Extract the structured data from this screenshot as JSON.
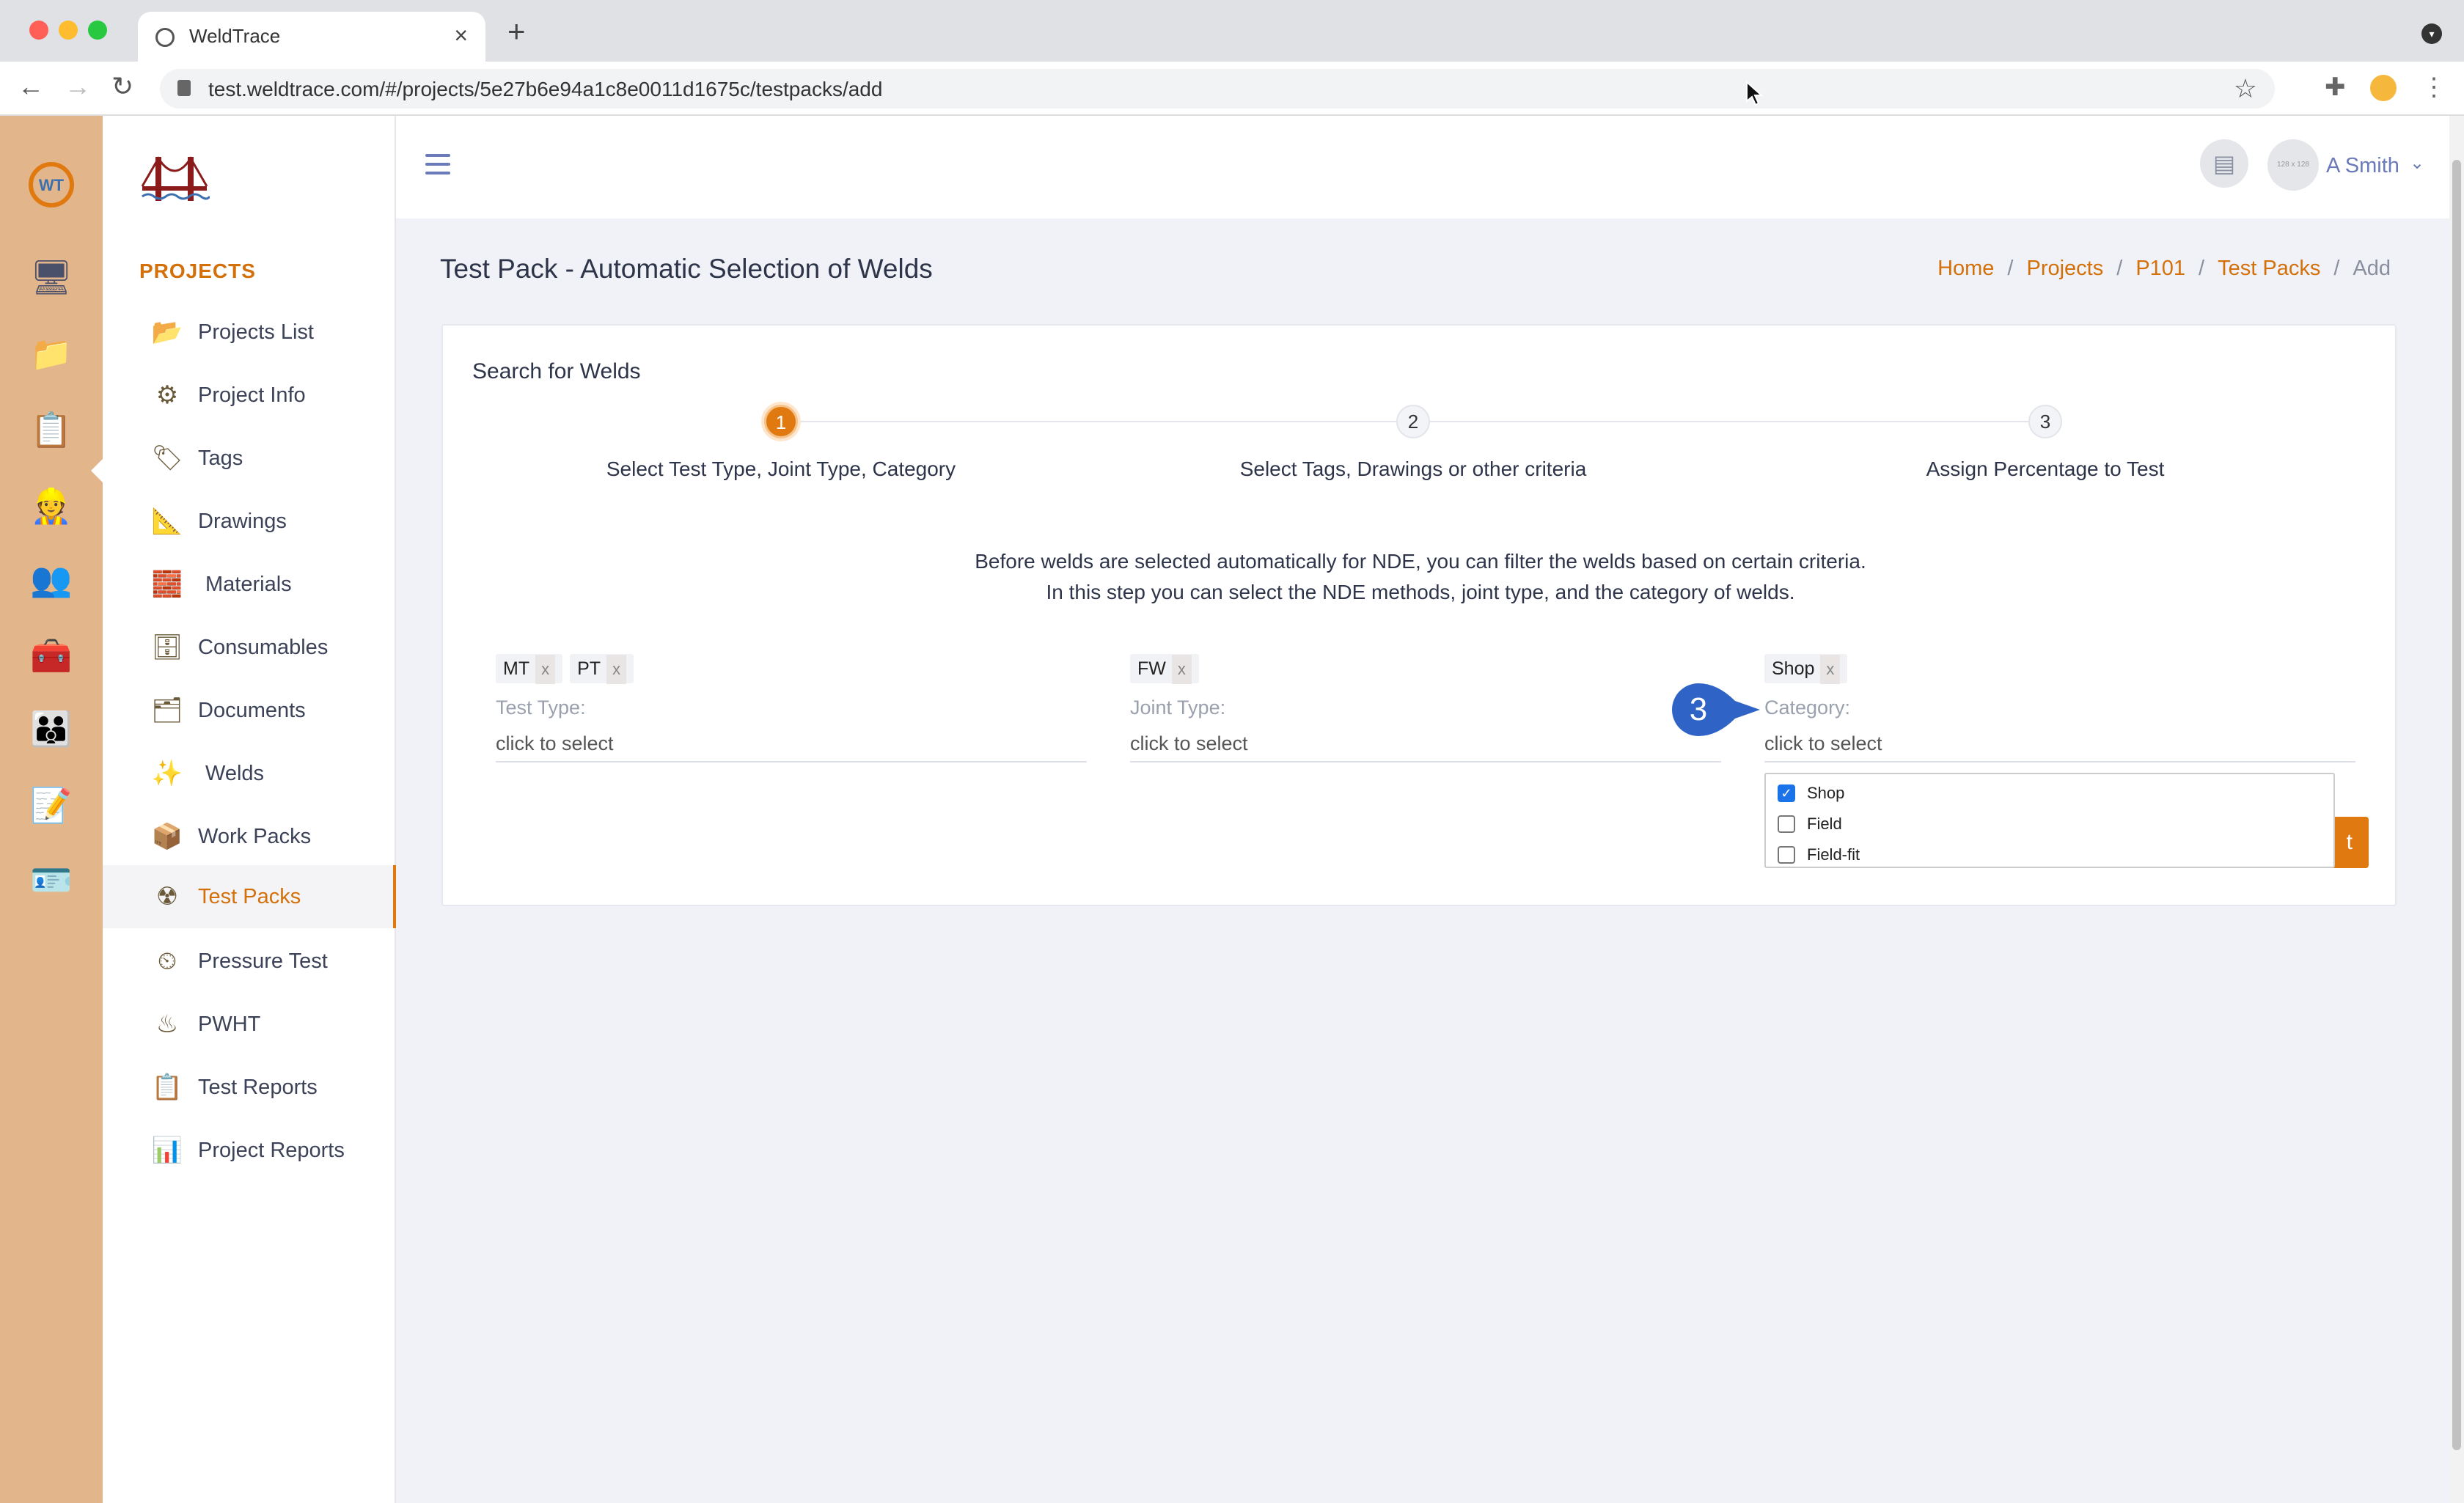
{
  "browser": {
    "tab_title": "WeldTrace",
    "url": "test.weldtrace.com/#/projects/5e27b6e94a1c8e0011d1675c/testpacks/add"
  },
  "sidebar": {
    "section_title": "PROJECTS",
    "items": [
      {
        "label": "Projects List",
        "icon": "camera-folder-icon"
      },
      {
        "label": "Project Info",
        "icon": "gears-icon"
      },
      {
        "label": "Tags",
        "icon": "tag-icon"
      },
      {
        "label": "Drawings",
        "icon": "drafting-icon"
      },
      {
        "label": "Materials",
        "icon": "pipes-stack-icon"
      },
      {
        "label": "Consumables",
        "icon": "welding-rods-icon"
      },
      {
        "label": "Documents",
        "icon": "document-folder-icon"
      },
      {
        "label": "Welds",
        "icon": "weld-spark-icon"
      },
      {
        "label": "Work Packs",
        "icon": "work-pack-folder-icon"
      },
      {
        "label": "Test Packs",
        "icon": "radiation-icon"
      },
      {
        "label": "Pressure Test",
        "icon": "pressure-gauge-icon"
      },
      {
        "label": "PWHT",
        "icon": "heater-coil-icon"
      },
      {
        "label": "Test Reports",
        "icon": "checklist-icon"
      },
      {
        "label": "Project Reports",
        "icon": "report-chart-icon"
      }
    ],
    "active_item": "Test Packs"
  },
  "topbar": {
    "avatar_text": "128 x 128",
    "user_name": "A Smith"
  },
  "page": {
    "title": "Test Pack - Automatic Selection of Welds",
    "breadcrumb": [
      {
        "label": "Home",
        "link": true
      },
      {
        "label": "Projects",
        "link": true
      },
      {
        "label": "P101",
        "link": true
      },
      {
        "label": "Test Packs",
        "link": true
      },
      {
        "label": "Add",
        "link": false
      }
    ]
  },
  "card": {
    "title": "Search for Welds",
    "steps": [
      {
        "number": "1",
        "label": "Select Test Type, Joint Type, Category",
        "active": true
      },
      {
        "number": "2",
        "label": "Select Tags, Drawings or other criteria",
        "active": false
      },
      {
        "number": "3",
        "label": "Assign Percentage to Test",
        "active": false
      }
    ],
    "intro_line1": "Before welds are selected automatically for NDE, you can filter the welds based on certain criteria.",
    "intro_line2": "In this step you can select the NDE methods, joint type, and the category of welds.",
    "fields": [
      {
        "chips": [
          "MT",
          "PT"
        ],
        "label": "Test Type:",
        "placeholder": "click to select"
      },
      {
        "chips": [
          "FW"
        ],
        "label": "Joint Type:",
        "placeholder": "click to select"
      },
      {
        "chips": [
          "Shop"
        ],
        "label": "Category:",
        "placeholder": "click to select"
      }
    ],
    "chip_remove": "x",
    "category_options": [
      {
        "label": "Shop",
        "checked": true
      },
      {
        "label": "Field",
        "checked": false
      },
      {
        "label": "Field-fit",
        "checked": false
      }
    ],
    "next_button_visible": "t",
    "callout_number": "3"
  },
  "colors": {
    "accent": "#e07a10",
    "callout": "#2f64c6",
    "rail": "#e3b58a"
  }
}
